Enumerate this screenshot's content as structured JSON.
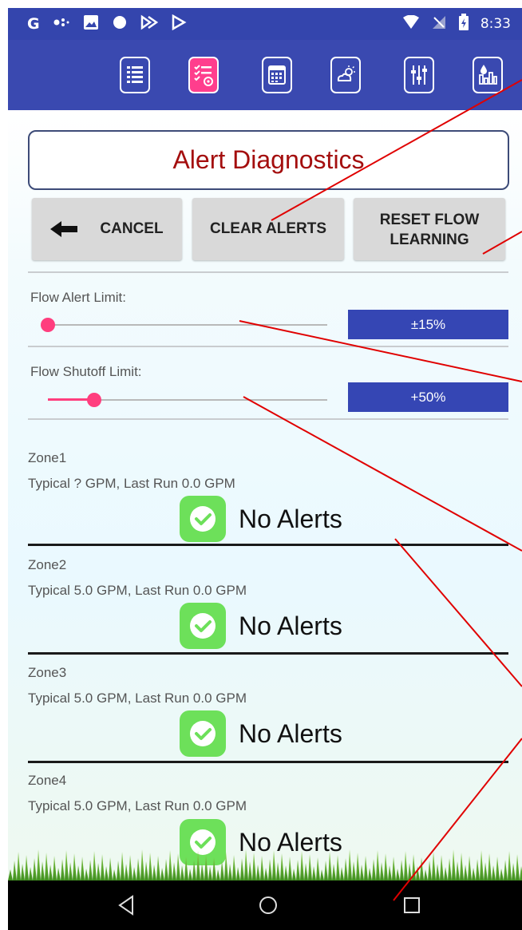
{
  "status_bar": {
    "left_icons": [
      "google-g-icon",
      "dots-icon",
      "image-icon",
      "circle-icon",
      "cast-icon",
      "play-store-icon"
    ],
    "g_letter": "G",
    "time": "8:33",
    "right_icons": [
      "wifi-icon",
      "no-signal-icon",
      "battery-charging-icon"
    ]
  },
  "toolbar": {
    "tabs": [
      {
        "icon": "list-icon",
        "active": false
      },
      {
        "icon": "checklist-settings-icon",
        "active": true
      },
      {
        "icon": "calendar-icon",
        "active": false
      },
      {
        "icon": "weather-icon",
        "active": false
      },
      {
        "icon": "sliders-icon",
        "active": false
      },
      {
        "icon": "water-chart-icon",
        "active": false
      }
    ],
    "accent_color": "#ff3e8d",
    "background_color": "#3a49b0"
  },
  "page": {
    "title": "Alert Diagnostics",
    "title_color": "#a40e0e"
  },
  "buttons": {
    "cancel": "CANCEL",
    "clear_alerts": "CLEAR ALERTS",
    "reset_flow_line1": "RESET FLOW",
    "reset_flow_line2": "LEARNING"
  },
  "sliders": {
    "flow_alert": {
      "label": "Flow Alert Limit:",
      "value": "±15%",
      "position_fraction": 0.0
    },
    "flow_shutoff": {
      "label": "Flow Shutoff Limit:",
      "value": "+50%",
      "position_fraction": 0.16
    }
  },
  "zones": [
    {
      "name": "Zone1",
      "typical": "Typical ? GPM, Last Run 0.0 GPM",
      "status": "No Alerts"
    },
    {
      "name": "Zone2",
      "typical": "Typical 5.0 GPM, Last Run 0.0 GPM",
      "status": "No Alerts"
    },
    {
      "name": "Zone3",
      "typical": "Typical 5.0 GPM, Last Run 0.0 GPM",
      "status": "No Alerts"
    },
    {
      "name": "Zone4",
      "typical": "Typical 5.0 GPM, Last Run 0.0 GPM",
      "status": "No Alerts"
    }
  ],
  "status_colors": {
    "ok": "#6de05a"
  },
  "navbar": {
    "items": [
      "back-icon",
      "home-icon",
      "recents-icon"
    ]
  },
  "annotation_color": "#e00000"
}
